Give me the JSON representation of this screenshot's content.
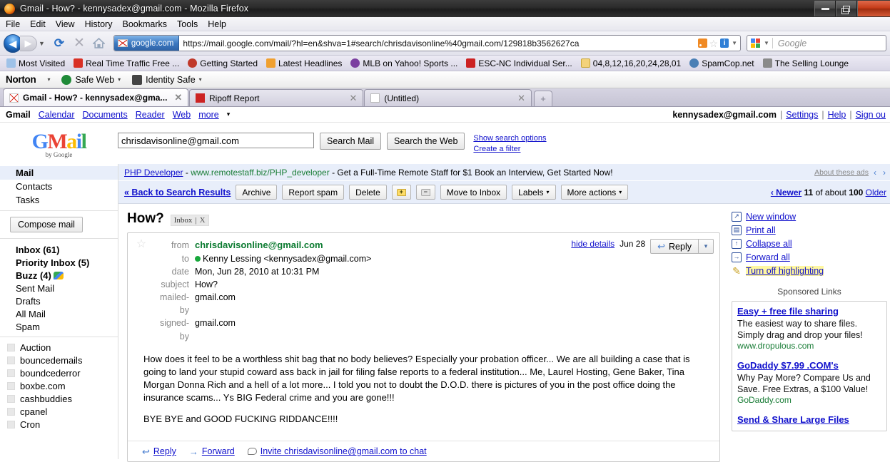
{
  "window": {
    "title": "Gmail - How? - kennysadex@gmail.com - Mozilla Firefox",
    "app_icon": "firefox-icon",
    "minimize": "–",
    "restore": "❐",
    "close": "×"
  },
  "menubar": [
    "File",
    "Edit",
    "View",
    "History",
    "Bookmarks",
    "Tools",
    "Help"
  ],
  "navbar": {
    "back": "◀",
    "forward": "▶",
    "reload": "⟳",
    "stop": "✕",
    "home": "home-icon",
    "identity_label": "google.com",
    "url": "https://mail.google.com/mail/?hl=en&shva=1#search/chrisdavisonline%40gmail.com/129818b3562627ca",
    "search_placeholder": "Google"
  },
  "bookmarks": [
    {
      "label": "Most Visited",
      "color": "#9fc2e8"
    },
    {
      "label": "Real Time Traffic Free ...",
      "color": "#d93025"
    },
    {
      "label": "Getting Started",
      "color": "#c0392b"
    },
    {
      "label": "Latest Headlines",
      "color": "#f0a030"
    },
    {
      "label": "MLB on Yahoo! Sports ...",
      "color": "#7b3fa0"
    },
    {
      "label": "ESC-NC Individual Ser...",
      "color": "#cc2222"
    },
    {
      "label": "04,8,12,16,20,24,28,01",
      "color": "#f3d27a"
    },
    {
      "label": "SpamCop.net",
      "color": "#4a7fb5"
    },
    {
      "label": "The Selling Lounge",
      "color": "#8a8a8a"
    }
  ],
  "norton": {
    "brand": "Norton",
    "items": [
      {
        "label": "Safe Web",
        "color": "#1f8a38"
      },
      {
        "label": "Identity Safe",
        "color": "#444444"
      }
    ],
    "caret": "▾"
  },
  "tabs": [
    {
      "label": "Gmail - How? - kennysadex@gma...",
      "icon": "gmail-favicon",
      "active": true,
      "close": "✕"
    },
    {
      "label": "Ripoff Report",
      "icon": "ripoff-favicon",
      "active": false,
      "close": "✕"
    },
    {
      "label": "(Untitled)",
      "icon": "blank-page-favicon",
      "active": false,
      "close": "✕"
    }
  ],
  "new_tab": "+",
  "gmail_top": {
    "product": "Gmail",
    "links": [
      "Calendar",
      "Documents",
      "Reader",
      "Web"
    ],
    "more": "more",
    "more_caret": "▾",
    "user": "kennysadex@gmail.com",
    "account_links": [
      "Settings",
      "Help",
      "Sign ou"
    ]
  },
  "logo": {
    "g": "G",
    "m": "M",
    "a": "a",
    "i": "i",
    "l": "l",
    "byline": "by Google"
  },
  "search": {
    "value": "chrisdavisonline@gmail.com",
    "placeholder": "Search mail",
    "search_mail": "Search Mail",
    "search_web": "Search the Web",
    "show_options": "Show search options",
    "create_filter": "Create a filter"
  },
  "sidebar": {
    "nav": [
      {
        "label": "Mail",
        "selected": true
      },
      {
        "label": "Contacts",
        "selected": false
      },
      {
        "label": "Tasks",
        "selected": false
      }
    ],
    "compose": "Compose mail",
    "system": [
      {
        "label": "Inbox (61)",
        "bold": true
      },
      {
        "label": "Priority Inbox (5)",
        "bold": true
      },
      {
        "label": "Buzz (4)",
        "bold": true,
        "icon": "buzz-icon"
      },
      {
        "label": "Sent Mail",
        "bold": false
      },
      {
        "label": "Drafts",
        "bold": false
      },
      {
        "label": "All Mail",
        "bold": false
      },
      {
        "label": "Spam",
        "bold": false
      }
    ],
    "labels": [
      "Auction",
      "bouncedemails",
      "boundcederror",
      "boxbe.com",
      "cashbuddies",
      "cpanel",
      "Cron"
    ]
  },
  "ad_banner": {
    "title": "PHP Developer",
    "dash1": "-",
    "url": "www.remotestaff.biz/PHP_developer",
    "dash2": "-",
    "text": "Get a Full-Time Remote Staff for $1 Book an Interview, Get Started Now!",
    "about": "About these ads",
    "prev": "‹",
    "next": "›"
  },
  "toolbar": {
    "back_to_results": "« Back to Search Results",
    "archive": "Archive",
    "report_spam": "Report spam",
    "delete": "Delete",
    "add_label": "+",
    "remove_label": "−",
    "move_to_inbox": "Move to Inbox",
    "labels": "Labels",
    "more_actions": "More actions",
    "caret": "▾",
    "pager_newer": "‹ Newer",
    "pager_count": "11",
    "pager_of": "of about",
    "pager_total": "100",
    "pager_older": "Older"
  },
  "message": {
    "subject": "How?",
    "label_chip": "Inbox",
    "label_chip_close": "X",
    "star": "☆",
    "fields": [
      {
        "label": "from",
        "value": "chrisdavisonline@gmail.com",
        "type": "from"
      },
      {
        "label": "to",
        "value": "Kenny Lessing <kennysadex@gmail.com>",
        "type": "to"
      },
      {
        "label": "date",
        "value": "Mon, Jun 28, 2010 at 10:31 PM",
        "type": "plain"
      },
      {
        "label": "subject",
        "value": "How?",
        "type": "plain"
      },
      {
        "label": "mailed-by",
        "value": "gmail.com",
        "type": "plain"
      },
      {
        "label": "signed-by",
        "value": "gmail.com",
        "type": "plain"
      }
    ],
    "hide_details": "hide details",
    "date_short": "Jun 28",
    "reply_button": "Reply",
    "reply_caret": "▾",
    "body_paragraphs": [
      "How does it feel to be a worthless shit bag that no body believes? Especially your probation officer... We are all building a case that is going to land your stupid coward ass back in jail for filing false reports to a federal institution... Me, Laurel Hosting, Gene Baker, Tina Morgan Donna Rich and a hell of a lot more... I told you not to doubt the D.O.D. there is pictures of you in the post office doing the insurance scams... Ys BIG Federal crime and you are gone!!!",
      "BYE BYE and GOOD FUCKING RIDDANCE!!!!"
    ],
    "footer": {
      "reply": "Reply",
      "forward": "Forward",
      "invite": "Invite chrisdavisonline@gmail.com to chat"
    }
  },
  "rail": {
    "actions": [
      {
        "label": "New window",
        "icon": "new-window-icon",
        "highlight": false
      },
      {
        "label": "Print all",
        "icon": "printer-icon",
        "highlight": false
      },
      {
        "label": "Collapse all",
        "icon": "collapse-icon",
        "highlight": false
      },
      {
        "label": "Forward all",
        "icon": "forward-icon",
        "highlight": false
      },
      {
        "label": "Turn off highlighting",
        "icon": "highlighter-icon",
        "highlight": true
      }
    ],
    "sponsored_title": "Sponsored Links",
    "ads": [
      {
        "title": "Easy + free file sharing",
        "line1": "The easiest way to share files.",
        "line2": "Simply drag and drop your files!",
        "url": "www.dropulous.com"
      },
      {
        "title": "GoDaddy $7.99 .COM's",
        "line1": "Why Pay More? Compare Us and",
        "line2": "Save. Free Extras, a $100 Value!",
        "url": "GoDaddy.com"
      },
      {
        "title": "Send & Share Large Files",
        "line1": "",
        "line2": "",
        "url": ""
      }
    ]
  },
  "colors": {
    "link": "#1111cc",
    "gmail_blue_panel": "#e8eefa",
    "from_green": "#0a7a2f",
    "highlight_yellow": "#fff7a0"
  }
}
